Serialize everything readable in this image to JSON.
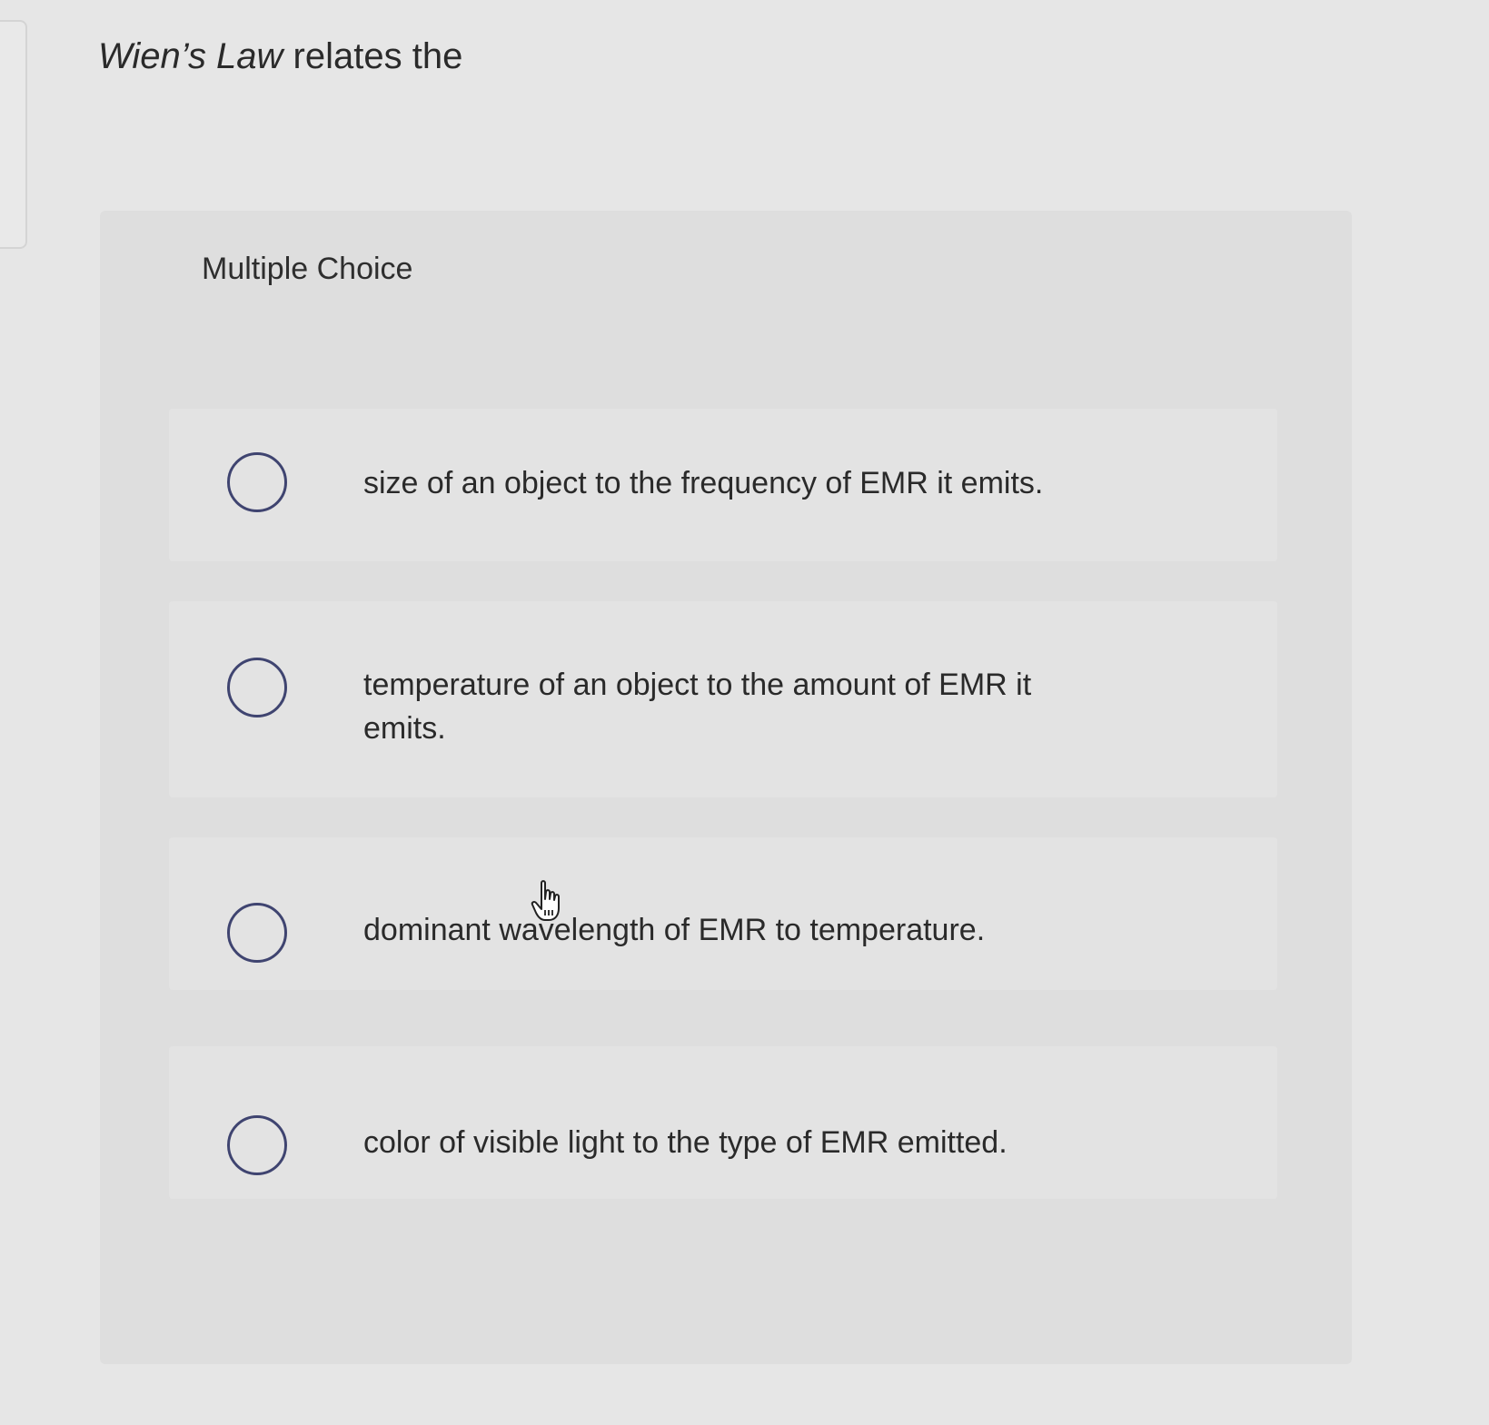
{
  "question": {
    "stem_italic": "Wien’s Law",
    "stem_rest": " relates the"
  },
  "panel": {
    "heading": "Multiple Choice"
  },
  "options": [
    {
      "text": "size of an object to the frequency of EMR it emits."
    },
    {
      "text": "temperature of an object to the amount of EMR it emits."
    },
    {
      "text": "dominant wavelength of EMR to temperature."
    },
    {
      "text": "color of visible light to the type of EMR emitted."
    }
  ],
  "icons": {
    "radio": "radio-unselected-icon",
    "cursor": "hand-pointer-icon"
  },
  "colors": {
    "radio_border": "#3f4470",
    "page_background": "#e6e6e6",
    "panel_background": "#dedede"
  }
}
